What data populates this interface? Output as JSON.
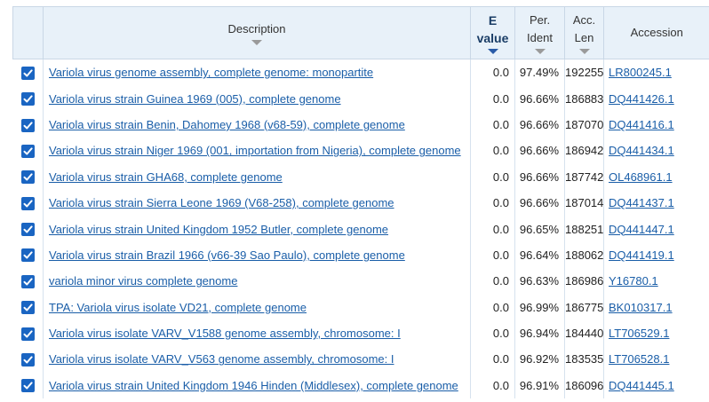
{
  "columns": {
    "description": "Description",
    "evalue_line1": "E",
    "evalue_line2": "value",
    "perident_line1": "Per.",
    "perident_line2": "Ident",
    "acclen_line1": "Acc.",
    "acclen_line2": "Len",
    "accession": "Accession"
  },
  "colors": {
    "link": "#1a5ea8",
    "checkbox": "#1a65c2",
    "header_bg": "#e8f1f9",
    "sort_active": "#2a5ca8"
  },
  "rows": [
    {
      "description": "Variola virus genome assembly, complete genome: monopartite",
      "evalue": "0.0",
      "per_ident": "97.49%",
      "acc_len": "192255",
      "accession": "LR800245.1",
      "checked": true
    },
    {
      "description": "Variola virus strain Guinea 1969 (005), complete genome",
      "evalue": "0.0",
      "per_ident": "96.66%",
      "acc_len": "186883",
      "accession": "DQ441426.1",
      "checked": true
    },
    {
      "description": "Variola virus strain Benin, Dahomey 1968 (v68-59), complete genome",
      "evalue": "0.0",
      "per_ident": "96.66%",
      "acc_len": "187070",
      "accession": "DQ441416.1",
      "checked": true
    },
    {
      "description": "Variola virus strain Niger 1969 (001, importation from Nigeria), complete genome",
      "evalue": "0.0",
      "per_ident": "96.66%",
      "acc_len": "186942",
      "accession": "DQ441434.1",
      "checked": true
    },
    {
      "description": "Variola virus strain GHA68, complete genome",
      "evalue": "0.0",
      "per_ident": "96.66%",
      "acc_len": "187742",
      "accession": "OL468961.1",
      "checked": true
    },
    {
      "description": "Variola virus strain Sierra Leone 1969 (V68-258), complete genome",
      "evalue": "0.0",
      "per_ident": "96.66%",
      "acc_len": "187014",
      "accession": "DQ441437.1",
      "checked": true
    },
    {
      "description": "Variola virus strain United Kingdom 1952 Butler, complete genome",
      "evalue": "0.0",
      "per_ident": "96.65%",
      "acc_len": "188251",
      "accession": "DQ441447.1",
      "checked": true
    },
    {
      "description": "Variola virus strain Brazil 1966 (v66-39 Sao Paulo), complete genome",
      "evalue": "0.0",
      "per_ident": "96.64%",
      "acc_len": "188062",
      "accession": "DQ441419.1",
      "checked": true
    },
    {
      "description": "variola minor virus complete genome",
      "evalue": "0.0",
      "per_ident": "96.63%",
      "acc_len": "186986",
      "accession": "Y16780.1",
      "checked": true
    },
    {
      "description": "TPA: Variola virus isolate VD21, complete genome",
      "evalue": "0.0",
      "per_ident": "96.99%",
      "acc_len": "186775",
      "accession": "BK010317.1",
      "checked": true
    },
    {
      "description": "Variola virus isolate VARV_V1588 genome assembly, chromosome: I",
      "evalue": "0.0",
      "per_ident": "96.94%",
      "acc_len": "184440",
      "accession": "LT706529.1",
      "checked": true
    },
    {
      "description": "Variola virus isolate VARV_V563 genome assembly, chromosome: I",
      "evalue": "0.0",
      "per_ident": "96.92%",
      "acc_len": "183535",
      "accession": "LT706528.1",
      "checked": true
    },
    {
      "description": "Variola virus strain United Kingdom 1946 Hinden (Middlesex), complete genome",
      "evalue": "0.0",
      "per_ident": "96.91%",
      "acc_len": "186096",
      "accession": "DQ441445.1",
      "checked": true
    }
  ]
}
